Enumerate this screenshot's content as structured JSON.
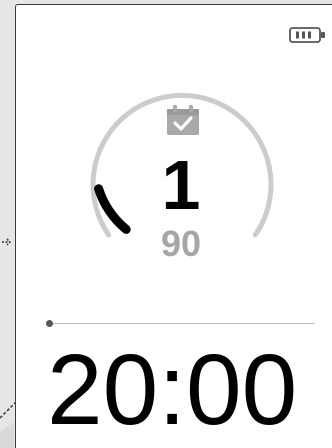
{
  "status_bar": {
    "battery_icon": "battery-icon",
    "battery_level": 0.6
  },
  "day_counter": {
    "icon": "calendar-check-icon",
    "current_day": "1",
    "total_days": "90",
    "progress": 0.011
  },
  "timer": {
    "progress": 0.0,
    "time": "20:00"
  },
  "colors": {
    "ring_track": "#cccccc",
    "ring_fill": "#000000",
    "total_text": "#a6a6a6",
    "icon": "#a9a9a9"
  }
}
